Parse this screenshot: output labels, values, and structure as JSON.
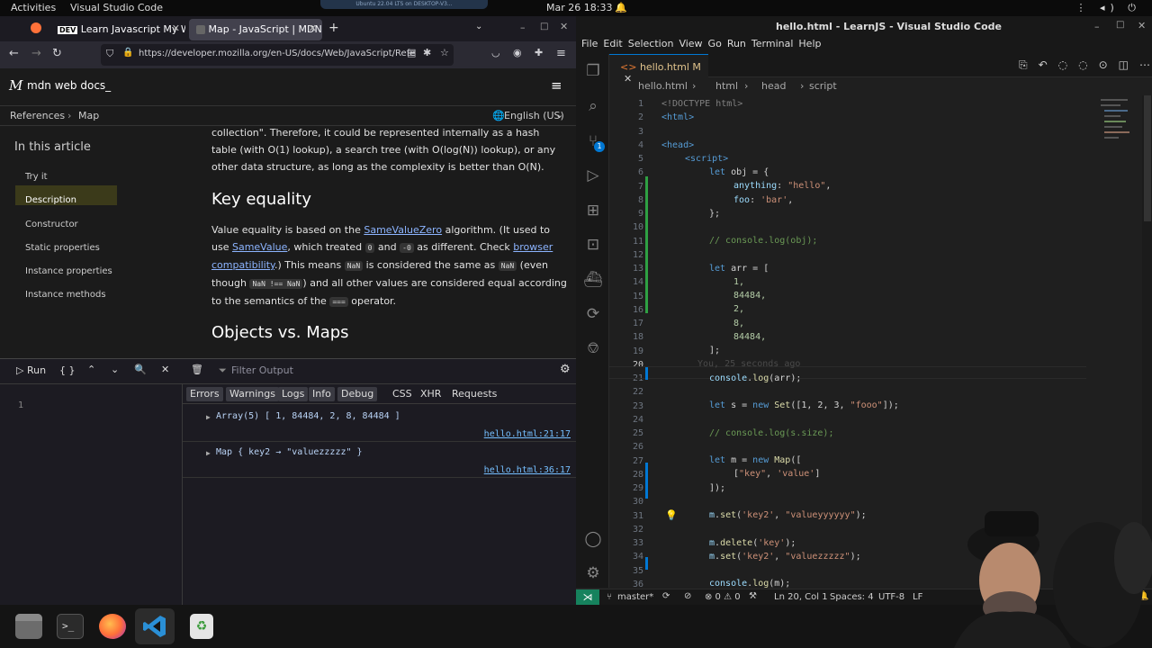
{
  "topbar": {
    "activities": "Activities",
    "app_name": "Visual Studio Code",
    "clock": "Mar 26  18:33",
    "vm_label": "Ubuntu 22.04 LTS on DESKTOP-V3..."
  },
  "firefox": {
    "tabs": [
      {
        "label": "Learn Javascript My Way"
      },
      {
        "label": "Map - JavaScript | MDN"
      }
    ],
    "url": "https://developer.mozilla.org/en-US/docs/Web/JavaScript/Refe",
    "mdn_logo": "mdn web docs_",
    "breadcrumb": [
      "References",
      "Map"
    ],
    "language": "English (US)",
    "toc_title": "In this article",
    "toc_items": [
      "Try it",
      "Description",
      "Constructor",
      "Static properties",
      "Instance properties",
      "Instance methods"
    ],
    "article": {
      "p1": "collection\". Therefore, it could be represented internally as a hash table (with O(1) lookup), a search tree (with O(log(N)) lookup), or any other data structure, as long as the complexity is better than O(N).",
      "h_key_equality": "Key equality",
      "p2_a": "Value equality is based on the ",
      "p2_link1": "SameValueZero",
      "p2_b": " algorithm. (It used to use ",
      "p2_link2": "SameValue",
      "p2_c": ", which treated ",
      "code_zero": "0",
      "p2_d": " and ",
      "code_negzero": "-0",
      "p2_e": " as different. Check ",
      "p2_link3": "browser compatibility",
      "p2_f": ".) This means ",
      "code_nan": "NaN",
      "p2_g": " is considered the same as ",
      "p2_h": " (even though ",
      "code_nan_ne": "NaN !== NaN",
      "p2_i": ") and all other values are considered equal according to the semantics of the ",
      "code_eqeqeq": "===",
      "p2_j": " operator.",
      "h_objects_vs_maps": "Objects vs. Maps"
    },
    "devtools": {
      "run": "Run",
      "braces": "{ }",
      "filter_placeholder": "Filter Output",
      "editor_line": "1",
      "filters": [
        "Errors",
        "Warnings",
        "Logs",
        "Info",
        "Debug"
      ],
      "filters2": [
        "CSS",
        "XHR",
        "Requests"
      ],
      "logs": [
        {
          "text": "Array(5) [ 1, 84484, 2, 8, 84484 ]",
          "loc": "hello.html:21:17"
        },
        {
          "text": "Map { key2 → \"valuezzzzz\" }",
          "loc": "hello.html:36:17"
        }
      ]
    }
  },
  "vscode": {
    "title": "hello.html - LearnJS - Visual Studio Code",
    "menu": [
      "File",
      "Edit",
      "Selection",
      "View",
      "Go",
      "Run",
      "Terminal",
      "Help"
    ],
    "tab_label": "hello.html",
    "tab_badge": "M",
    "breadcrumb": [
      "hello.html",
      "html",
      "head",
      "script"
    ],
    "scm_badge": "1",
    "inline_blame": "You, 25 seconds ago",
    "status": {
      "branch": "master*",
      "problems": "⊗ 0 ⚠ 0",
      "position": "Ln 20, Col 1",
      "spaces": "Spaces: 4",
      "encoding": "UTF-8",
      "eol": "LF"
    },
    "code_lines": [
      "1",
      "2",
      "3",
      "4",
      "5",
      "6",
      "7",
      "8",
      "9",
      "10",
      "11",
      "12",
      "13",
      "14",
      "15",
      "16",
      "17",
      "18",
      "19",
      "20",
      "21",
      "22",
      "23",
      "24",
      "25",
      "26",
      "27",
      "28",
      "29",
      "30",
      "31",
      "32",
      "33",
      "34",
      "35",
      "36"
    ],
    "code": {
      "l1": "<!DOCTYPE html>",
      "l2": "<html>",
      "l4": "<head>",
      "l5": "<script>",
      "l6a": "let",
      "l6b": " obj = {",
      "l7a": "anything",
      "l7b": ": ",
      "l7c": "\"hello\"",
      "l7d": ",",
      "l8a": "foo",
      "l8b": ": ",
      "l8c": "'bar'",
      "l8d": ",",
      "l9": "};",
      "l11": "// console.log(obj);",
      "l13a": "let",
      "l13b": " arr = [",
      "l14": "1,",
      "l15": "84484,",
      "l16": "2,",
      "l17": "8,",
      "l18": "84484,",
      "l19": "];",
      "l21a": "console",
      "l21b": ".",
      "l21c": "log",
      "l21d": "(arr);",
      "l23a": "let",
      "l23b": " s = ",
      "l23c": "new",
      "l23d": " ",
      "l23e": "Set",
      "l23f": "([1, 2, 3, ",
      "l23g": "\"fooo\"",
      "l23h": "]);",
      "l25": "// console.log(s.size);",
      "l27a": "let",
      "l27b": " m = ",
      "l27c": "new",
      "l27d": " ",
      "l27e": "Map",
      "l27f": "([",
      "l28a": "[",
      "l28b": "\"key\"",
      "l28c": ", ",
      "l28d": "'value'",
      "l28e": "]",
      "l29": "]);",
      "l31a": "m",
      "l31b": ".",
      "l31c": "set",
      "l31d": "(",
      "l31e": "'key2'",
      "l31f": ", ",
      "l31g": "\"valueyyyyyy\"",
      "l31h": ");",
      "l33a": "m",
      "l33b": ".",
      "l33c": "delete",
      "l33d": "(",
      "l33e": "'key'",
      "l33f": ");",
      "l34a": "m",
      "l34b": ".",
      "l34c": "set",
      "l34d": "(",
      "l34e": "'key2'",
      "l34f": ", ",
      "l34g": "\"valuezzzzz\"",
      "l34h": ");",
      "l36a": "console",
      "l36b": ".",
      "l36c": "log",
      "l36d": "(m);"
    }
  },
  "colors": {
    "accent": "#0078d4",
    "mdn_highlight": "#3b3a1a",
    "link": "#8cb4ff"
  },
  "icons": [
    "firefox-icon",
    "files-icon",
    "terminal-icon",
    "vscode-icon",
    "trash-icon",
    "webcam-overlay"
  ]
}
